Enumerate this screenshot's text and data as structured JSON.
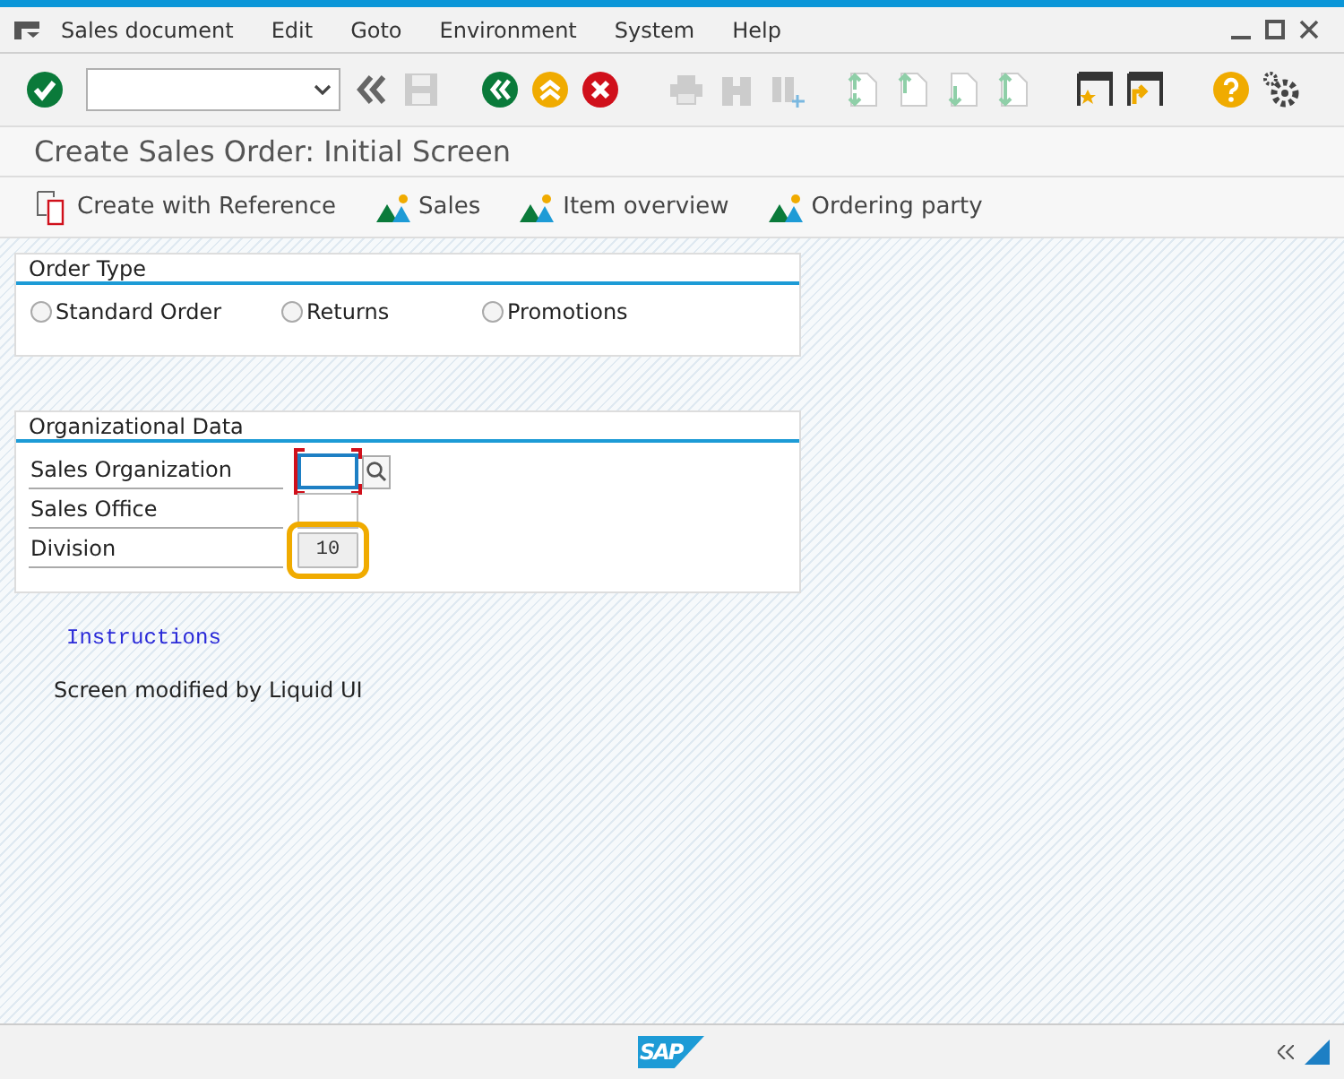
{
  "menu": [
    "Sales document",
    "Edit",
    "Goto",
    "Environment",
    "System",
    "Help"
  ],
  "title": "Create Sales Order: Initial Screen",
  "app_toolbar": [
    {
      "kind": "reference",
      "label": "Create with Reference"
    },
    {
      "kind": "people",
      "label": "Sales"
    },
    {
      "kind": "people",
      "label": "Item overview"
    },
    {
      "kind": "people",
      "label": "Ordering party"
    }
  ],
  "order_type": {
    "title": "Order Type",
    "options": [
      {
        "label": "Standard Order",
        "selected": false
      },
      {
        "label": "Returns",
        "selected": false
      },
      {
        "label": "Promotions",
        "selected": false
      }
    ]
  },
  "org_data": {
    "title": "Organizational Data",
    "fields": [
      {
        "label": "Sales Organization",
        "required": true,
        "search": true,
        "highlighted": false
      },
      {
        "label": "Sales Office",
        "required": false,
        "search": false,
        "highlighted": false
      },
      {
        "label": "Division",
        "value": "10",
        "required": false,
        "search": false,
        "highlighted": true
      }
    ]
  },
  "instructions_link": "Instructions",
  "note": "Screen modified by Liquid UI",
  "logo_text": "SAP"
}
